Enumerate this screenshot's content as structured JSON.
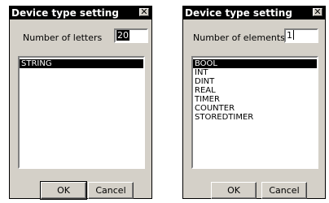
{
  "dialogs": [
    {
      "title": "Device type setting",
      "close_icon": "✕",
      "field_label": "Number of letters",
      "field_value": "20",
      "list_items": [
        "STRING"
      ],
      "selected_index": 0,
      "ok_label": "OK",
      "cancel_label": "Cancel"
    },
    {
      "title": "Device type setting",
      "close_icon": "✕",
      "field_label": "Number of elements",
      "field_value": "1",
      "list_items": [
        "BOOL",
        "INT",
        "DINT",
        "REAL",
        "TIMER",
        "COUNTER",
        "STOREDTIMER"
      ],
      "selected_index": 0,
      "ok_label": "OK",
      "cancel_label": "Cancel"
    }
  ],
  "icons": {
    "close": "close-icon"
  },
  "colors": {
    "dialog_face": "#d4d0c8",
    "titlebar": "#000000",
    "selection": "#000000"
  }
}
